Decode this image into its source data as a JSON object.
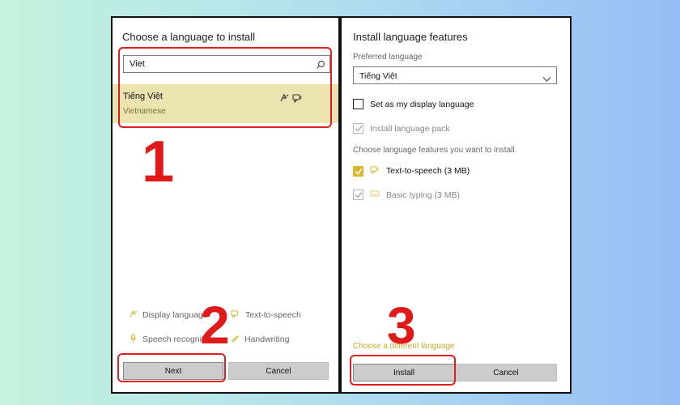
{
  "left_dialog": {
    "title": "Choose a language to install",
    "search": {
      "value": "Viet"
    },
    "result": {
      "native_name": "Tiếng Việt",
      "english_name": "Vietnamese"
    },
    "features": [
      {
        "icon": "display-language-icon",
        "label": "Display language"
      },
      {
        "icon": "text-to-speech-icon",
        "label": "Text-to-speech"
      },
      {
        "icon": "speech-recognition-icon",
        "label": "Speech recognition"
      },
      {
        "icon": "handwriting-icon",
        "label": "Handwriting"
      }
    ],
    "buttons": {
      "next": "Next",
      "cancel": "Cancel"
    }
  },
  "right_dialog": {
    "title": "Install language features",
    "preferred_label": "Preferred language",
    "preferred_value": "Tiếng Việt",
    "options": [
      {
        "label": "Set as my display language",
        "checked": false,
        "enabled": true
      },
      {
        "label": "Install language pack",
        "checked": true,
        "enabled": false
      }
    ],
    "features_label": "Choose language features you want to install.",
    "features": [
      {
        "label": "Text-to-speech (3 MB)",
        "checked": true,
        "enabled": true,
        "icon": "text-to-speech-icon"
      },
      {
        "label": "Basic typing (3 MB)",
        "checked": true,
        "enabled": false,
        "icon": "keyboard-icon"
      }
    ],
    "link": "Choose a different language",
    "buttons": {
      "install": "Install",
      "cancel": "Cancel"
    }
  },
  "annotations": {
    "step1": "1",
    "step2": "2",
    "step3": "3"
  },
  "colors": {
    "highlight": "#ece4b0",
    "annotation_red": "#e02020",
    "accent_gold": "#d6b82c"
  }
}
